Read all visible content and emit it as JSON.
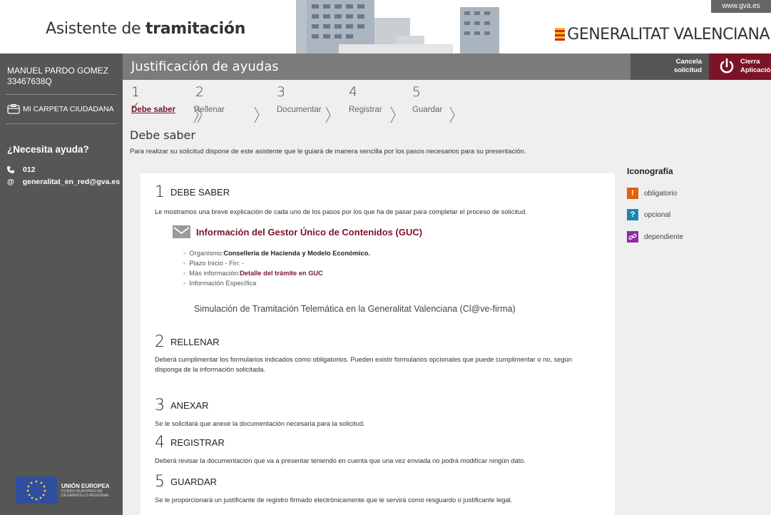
{
  "header": {
    "gva_link": "www.gva.es",
    "app_title_prefix": "Asistente de ",
    "app_title_bold": "tramitación",
    "brand": "GENERALITAT VALENCIANA"
  },
  "sidebar": {
    "user_name": "MANUEL PARDO GOMEZ",
    "user_id": "33467638Q",
    "carpeta": "MI CARPETA CIUDADANA",
    "help_title": "¿Necesita ayuda?",
    "phone": "012",
    "email": "generalitat_en_red@gva.es",
    "eu_title": "UNIÓN EUROPEA",
    "eu_line1": "FONDO EUROPEO DE",
    "eu_line2": "DESARROLLO REGIONAL"
  },
  "titlebar": {
    "title": "Justificación de ayudas",
    "cancel_l1": "Cancela",
    "cancel_l2": "solicitud",
    "close_l1": "Cierra",
    "close_l2": "Aplicación"
  },
  "steps": [
    {
      "num": "1",
      "label": "Debe saber"
    },
    {
      "num": "2",
      "label": "Rellenar"
    },
    {
      "num": "3",
      "label": "Documentar"
    },
    {
      "num": "4",
      "label": "Registrar"
    },
    {
      "num": "5",
      "label": "Guardar"
    }
  ],
  "section": {
    "title": "Debe saber",
    "desc": "Para realizar su solicitud dispone de este asistente que le guiará de manera sencilla por los pasos necesarios para su presentación."
  },
  "panel": {
    "s1_num": "1",
    "s1_title": "DEBE SABER",
    "s1_text": "Le mostramos una breve explicación de cada uno de los pasos por los que ha de pasar para completar el proceso de solicitud.",
    "guc_title": "Información del Gestor Único de Contenidos (GUC)",
    "org_label": "Organismo:",
    "org_value": "Conselleria de Hacienda y Modelo Económico.",
    "plazo": "Plazo Inicio - Fin: -",
    "mas_label": "Más información:",
    "mas_value": "Detalle del trámite en GUC",
    "info_esp": "Información Específica",
    "sim": "Simulación de Tramitación Telemática en la Generalitat Valenciana (Cl@ve-firma)",
    "s2_num": "2",
    "s2_title": "RELLENAR",
    "s2_text1": "Deberá cumplimentar los formularios indicados como obligatorios. Pueden existir formularios opcionales que puede cumplimentar o no, según",
    "s2_text2": "disponga de la información solicitada.",
    "s3_num": "3",
    "s3_title": "ANEXAR",
    "s3_text": "Se le solicitará que anexe la documentación necesaria para la solicitud.",
    "s4_num": "4",
    "s4_title": "REGISTRAR",
    "s4_text": "Deberá revisar la documentación que va a presentar teniendo en cuenta que una vez enviada no podrá modificar ningún dato.",
    "s5_num": "5",
    "s5_title": "GUARDAR",
    "s5_text": "Se le proporcionará un justificante de registro firmado electrónicamente que le servirá como resguardo o justificante legal."
  },
  "iconografia": {
    "title": "Iconografía",
    "items": [
      {
        "label": "obligatorio",
        "glyph": "!",
        "color": "#e2620e"
      },
      {
        "label": "opcional",
        "glyph": "?",
        "color": "#1d86b0"
      },
      {
        "label": "dependiente",
        "glyph": "🔗",
        "color": "#8e2aa0"
      }
    ]
  },
  "colors": {
    "accent": "#7a1428",
    "sidebar": "#565656",
    "titlebar": "#7b7b7b"
  }
}
